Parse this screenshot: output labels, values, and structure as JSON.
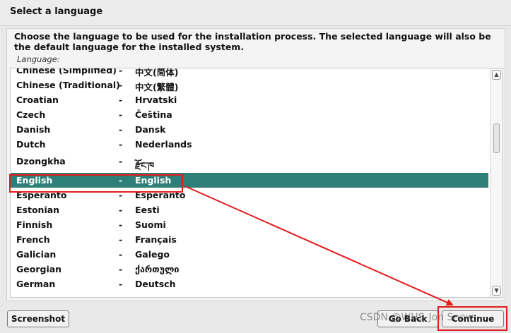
{
  "header": {
    "title": "Select a language"
  },
  "description": "Choose the language to be used for the installation process. The selected language will also be the default language for the installed system.",
  "list_label": "Language:",
  "languages": [
    {
      "name": "Chinese (Simplified)",
      "dash": "-",
      "native": "中文(简体)"
    },
    {
      "name": "Chinese (Traditional)",
      "dash": "-",
      "native": "中文(繁體)"
    },
    {
      "name": "Croatian",
      "dash": "-",
      "native": "Hrvatski"
    },
    {
      "name": "Czech",
      "dash": "-",
      "native": "Čeština"
    },
    {
      "name": "Danish",
      "dash": "-",
      "native": "Dansk"
    },
    {
      "name": "Dutch",
      "dash": "-",
      "native": "Nederlands"
    },
    {
      "name": "Dzongkha",
      "dash": "-",
      "native": "རྫོང་ཁ"
    },
    {
      "name": "English",
      "dash": "-",
      "native": "English"
    },
    {
      "name": "Esperanto",
      "dash": "-",
      "native": "Esperanto"
    },
    {
      "name": "Estonian",
      "dash": "-",
      "native": "Eesti"
    },
    {
      "name": "Finnish",
      "dash": "-",
      "native": "Suomi"
    },
    {
      "name": "French",
      "dash": "-",
      "native": "Français"
    },
    {
      "name": "Galician",
      "dash": "-",
      "native": "Galego"
    },
    {
      "name": "Georgian",
      "dash": "-",
      "native": "ქართული"
    },
    {
      "name": "German",
      "dash": "-",
      "native": "Deutsch"
    }
  ],
  "selected_language": "English",
  "buttons": {
    "screenshot": "Screenshot",
    "go_back": "Go Back",
    "continue": "Continue"
  },
  "watermark": "CSDN @WHS-Jon Snow",
  "colors": {
    "selection": "#2e7f77",
    "annotation": "#e31c1c"
  },
  "icons": {
    "scroll_up": "chevron-up-icon",
    "scroll_down": "chevron-down-icon"
  }
}
